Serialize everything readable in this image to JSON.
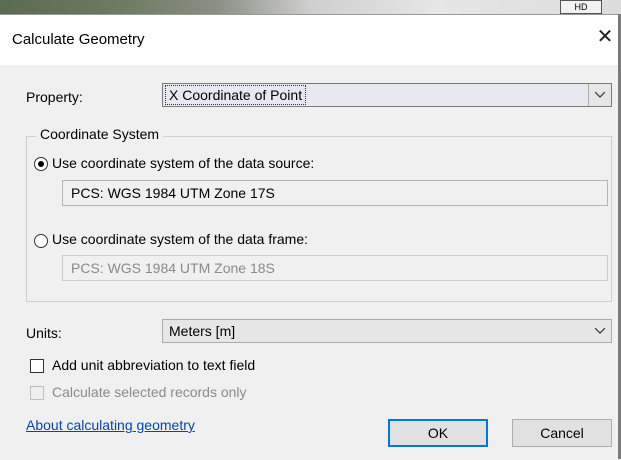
{
  "background": {
    "button_text": "HD"
  },
  "dialog": {
    "title": "Calculate Geometry",
    "close_glyph": "✕",
    "property": {
      "label": "Property:",
      "value": "X Coordinate of Point"
    },
    "coordinate_system": {
      "group_title": "Coordinate System",
      "option_source": {
        "label": "Use coordinate system of the data source:",
        "selected": true,
        "value": "PCS: WGS 1984 UTM Zone 17S"
      },
      "option_frame": {
        "label": "Use coordinate system of the data frame:",
        "selected": false,
        "value": "PCS: WGS 1984 UTM Zone 18S"
      }
    },
    "units": {
      "label": "Units:",
      "value": "Meters [m]"
    },
    "add_abbreviation": {
      "label": "Add unit abbreviation to text field",
      "checked": false
    },
    "selected_only": {
      "label": "Calculate selected records only",
      "checked": false,
      "enabled": false
    },
    "help_link": "About calculating geometry",
    "ok_label": "OK",
    "cancel_label": "Cancel"
  },
  "icons": {
    "close": "close-icon",
    "dropdown": "chevron-down-icon"
  },
  "colors": {
    "dialog_bg": "#f0f0f0",
    "link": "#0645ad",
    "focus_border": "#0078d7"
  }
}
